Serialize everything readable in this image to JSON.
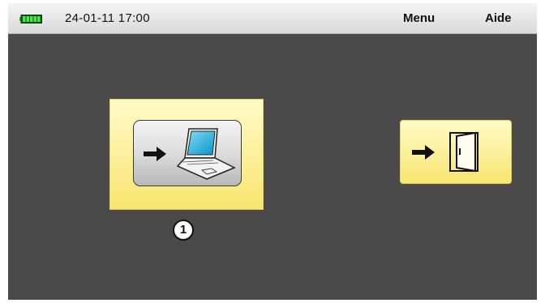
{
  "statusbar": {
    "battery_icon": "battery-icon",
    "datetime": "24-01-11 17:00",
    "menu_label": "Menu",
    "help_label": "Aide"
  },
  "tiles": [
    {
      "name": "transfer-to-pc",
      "icons": [
        "arrow-right-icon",
        "laptop-icon"
      ],
      "selected": true
    },
    {
      "name": "exit",
      "icons": [
        "arrow-right-icon",
        "door-icon"
      ],
      "selected": false
    }
  ],
  "badge": {
    "value": "1"
  },
  "colors": {
    "background": "#4a4a4a",
    "tile": "#f7e56f",
    "battery": "#2fb52f"
  }
}
